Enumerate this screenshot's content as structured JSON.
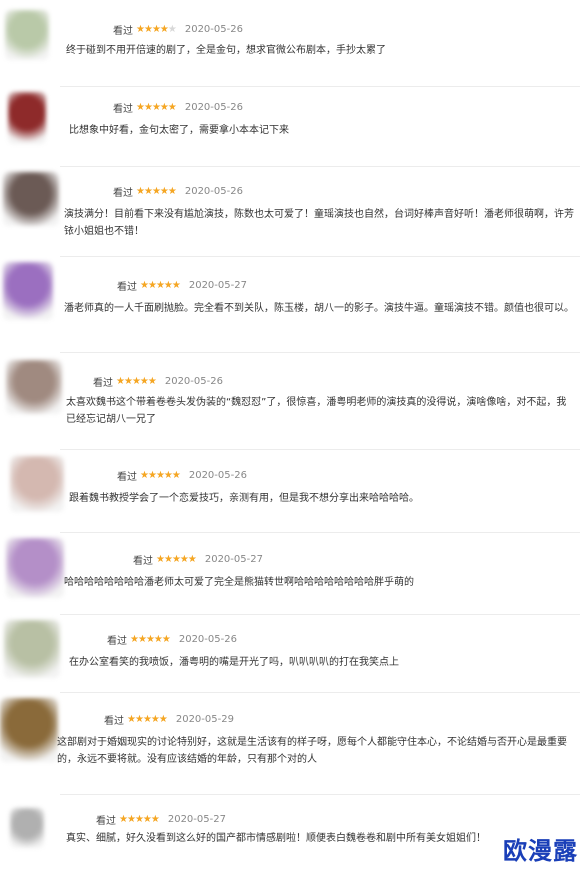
{
  "reviews": [
    {
      "status": "看过",
      "rating": 4,
      "date": "2020-05-26",
      "text": "终于碰到不用开倍速的剧了，全是金句，想求官微公布剧本，手抄太累了",
      "avatar_color": "#b9c9a8"
    },
    {
      "status": "看过",
      "rating": 5,
      "date": "2020-05-26",
      "text": "比想象中好看，金句太密了，需要拿小本本记下来",
      "avatar_color": "#8e2a2a"
    },
    {
      "status": "看过",
      "rating": 5,
      "date": "2020-05-26",
      "text": "演技满分！目前看下来没有尴尬演技，陈数也太可爱了！童瑶演技也自然，台词好棒声音好听！潘老师很萌啊，许芳铱小姐姐也不错！",
      "avatar_color": "#6b5a55"
    },
    {
      "status": "看过",
      "rating": 5,
      "date": "2020-05-27",
      "text": "潘老师真的一人千面刷抛脸。完全看不到关队，陈玉楼，胡八一的影子。演技牛逼。童瑶演技不错。颜值也很可以。",
      "avatar_color": "#9b6fc0"
    },
    {
      "status": "看过",
      "rating": 5,
      "date": "2020-05-26",
      "text": "太喜欢魏书这个带着卷卷头发伪装的“魏怼怼”了，很惊喜，潘粤明老师的演技真的没得说，演啥像啥，对不起，我已经忘记胡八一兄了",
      "avatar_color": "#a08a80"
    },
    {
      "status": "看过",
      "rating": 5,
      "date": "2020-05-26",
      "text": "跟着魏书教授学会了一个恋爱技巧，亲测有用，但是我不想分享出来哈哈哈哈。",
      "avatar_color": "#d4b8b0"
    },
    {
      "status": "看过",
      "rating": 5,
      "date": "2020-05-27",
      "text": "哈哈哈哈哈哈哈哈潘老师太可爱了完全是熊猫转世啊哈哈哈哈哈哈哈哈胖乎萌的",
      "avatar_color": "#b48fc8"
    },
    {
      "status": "看过",
      "rating": 5,
      "date": "2020-05-26",
      "text": "在办公室看笑的我喷饭，潘粤明的嘴是开光了吗，叭叭叭叭的打在我笑点上",
      "avatar_color": "#b8c0a4"
    },
    {
      "status": "看过",
      "rating": 5,
      "date": "2020-05-29",
      "text": "这部剧对于婚姻现实的讨论特别好，这就是生活该有的样子呀，愿每个人都能守住本心，不论结婚与否开心是最重要的，永远不要将就。没有应该结婚的年龄，只有那个对的人",
      "avatar_color": "#8a6a3a"
    },
    {
      "status": "看过",
      "rating": 5,
      "date": "2020-05-27",
      "text": "真实、细腻，好久没看到这么好的国产都市情感剧啦！顺便表白魏卷卷和剧中所有美女姐姐们！",
      "avatar_color": "#b0b0b0"
    }
  ],
  "watermark": "欧漫露"
}
